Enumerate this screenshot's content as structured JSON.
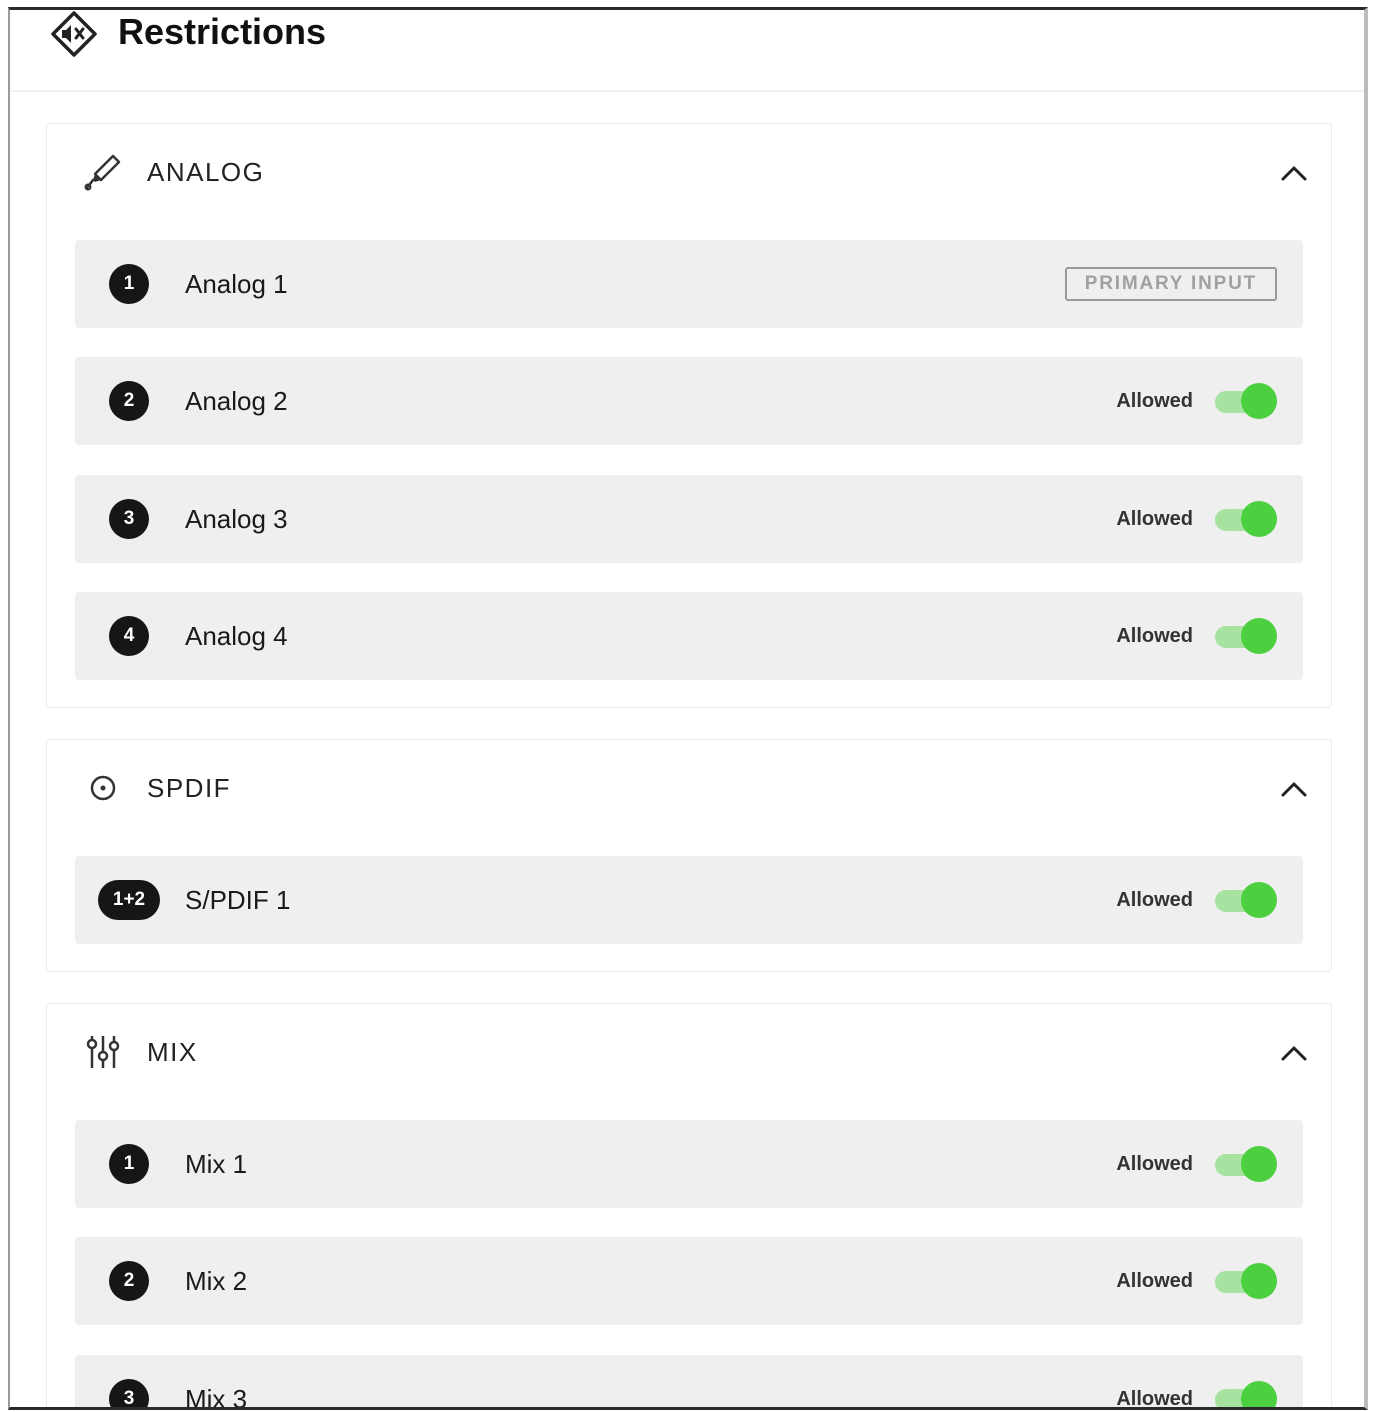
{
  "header": {
    "title": "Restrictions",
    "icon": "speaker-mute-diamond-icon"
  },
  "sections": {
    "analog": {
      "title": "ANALOG",
      "icon": "audio-jack-icon",
      "items": [
        {
          "badge": "1",
          "label": "Analog 1",
          "tag": "PRIMARY INPUT"
        },
        {
          "badge": "2",
          "label": "Analog 2",
          "status": "Allowed",
          "enabled": true
        },
        {
          "badge": "3",
          "label": "Analog 3",
          "status": "Allowed",
          "enabled": true
        },
        {
          "badge": "4",
          "label": "Analog 4",
          "status": "Allowed",
          "enabled": true
        }
      ]
    },
    "spdif": {
      "title": "SPDIF",
      "icon": "circle-dot-icon",
      "items": [
        {
          "badge": "1+2",
          "label": "S/PDIF 1",
          "status": "Allowed",
          "enabled": true
        }
      ]
    },
    "mix": {
      "title": "MIX",
      "icon": "mixer-sliders-icon",
      "items": [
        {
          "badge": "1",
          "label": "Mix 1",
          "status": "Allowed",
          "enabled": true
        },
        {
          "badge": "2",
          "label": "Mix 2",
          "status": "Allowed",
          "enabled": true
        },
        {
          "badge": "3",
          "label": "Mix 3",
          "status": "Allowed",
          "enabled": true
        }
      ]
    }
  },
  "colors": {
    "toggle_on_track": "#a6e3a0",
    "toggle_on_knob": "#4cd040",
    "row_bg": "#efefef",
    "badge_bg": "#161616"
  }
}
